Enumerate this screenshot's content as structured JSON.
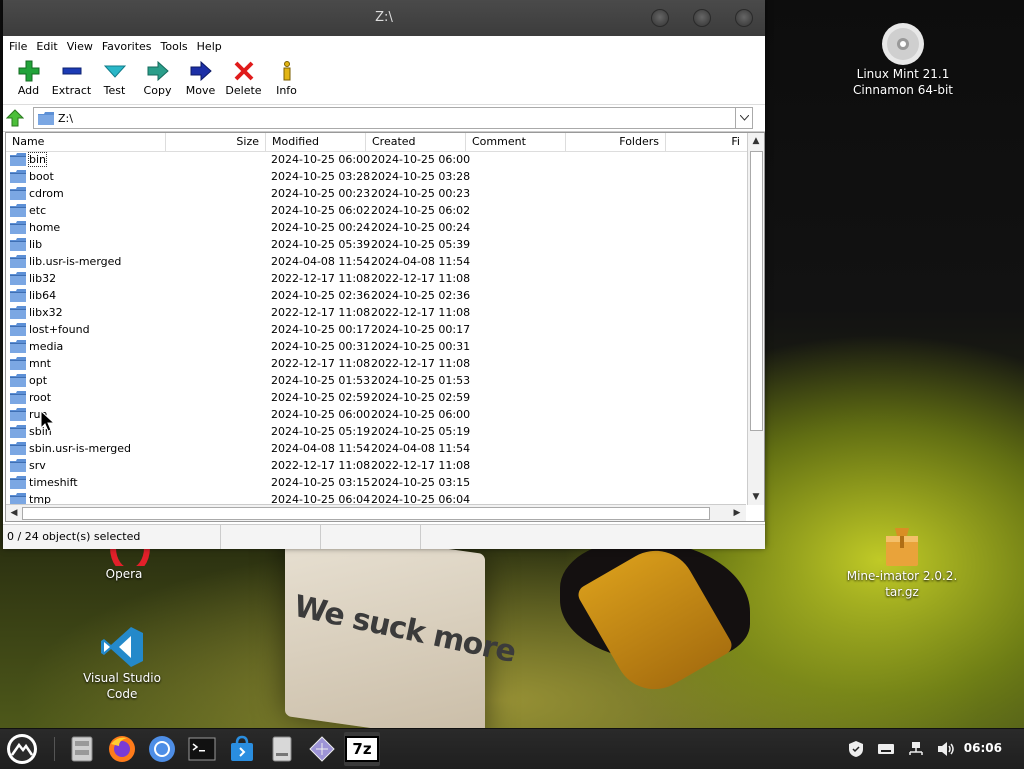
{
  "window": {
    "title": "Z:\\",
    "menu": [
      "File",
      "Edit",
      "View",
      "Favorites",
      "Tools",
      "Help"
    ],
    "toolbar": [
      {
        "label": "Add",
        "icon": "add-plus-icon"
      },
      {
        "label": "Extract",
        "icon": "extract-minus-icon"
      },
      {
        "label": "Test",
        "icon": "test-check-icon"
      },
      {
        "label": "Copy",
        "icon": "copy-arrow-icon"
      },
      {
        "label": "Move",
        "icon": "move-arrow-icon"
      },
      {
        "label": "Delete",
        "icon": "delete-x-icon"
      },
      {
        "label": "Info",
        "icon": "info-icon"
      }
    ],
    "address": "Z:\\",
    "columns": [
      "Name",
      "Size",
      "Modified",
      "Created",
      "Comment",
      "Folders",
      "Fi"
    ],
    "rows": [
      {
        "name": "bin",
        "modified": "2024-10-25 06:00",
        "created": "2024-10-25 06:00"
      },
      {
        "name": "boot",
        "modified": "2024-10-25 03:28",
        "created": "2024-10-25 03:28"
      },
      {
        "name": "cdrom",
        "modified": "2024-10-25 00:23",
        "created": "2024-10-25 00:23"
      },
      {
        "name": "etc",
        "modified": "2024-10-25 06:02",
        "created": "2024-10-25 06:02"
      },
      {
        "name": "home",
        "modified": "2024-10-25 00:24",
        "created": "2024-10-25 00:24"
      },
      {
        "name": "lib",
        "modified": "2024-10-25 05:39",
        "created": "2024-10-25 05:39"
      },
      {
        "name": "lib.usr-is-merged",
        "modified": "2024-04-08 11:54",
        "created": "2024-04-08 11:54"
      },
      {
        "name": "lib32",
        "modified": "2022-12-17 11:08",
        "created": "2022-12-17 11:08"
      },
      {
        "name": "lib64",
        "modified": "2024-10-25 02:36",
        "created": "2024-10-25 02:36"
      },
      {
        "name": "libx32",
        "modified": "2022-12-17 11:08",
        "created": "2022-12-17 11:08"
      },
      {
        "name": "lost+found",
        "modified": "2024-10-25 00:17",
        "created": "2024-10-25 00:17"
      },
      {
        "name": "media",
        "modified": "2024-10-25 00:31",
        "created": "2024-10-25 00:31"
      },
      {
        "name": "mnt",
        "modified": "2022-12-17 11:08",
        "created": "2022-12-17 11:08"
      },
      {
        "name": "opt",
        "modified": "2024-10-25 01:53",
        "created": "2024-10-25 01:53"
      },
      {
        "name": "root",
        "modified": "2024-10-25 02:59",
        "created": "2024-10-25 02:59"
      },
      {
        "name": "run",
        "modified": "2024-10-25 06:00",
        "created": "2024-10-25 06:00"
      },
      {
        "name": "sbin",
        "modified": "2024-10-25 05:19",
        "created": "2024-10-25 05:19"
      },
      {
        "name": "sbin.usr-is-merged",
        "modified": "2024-04-08 11:54",
        "created": "2024-04-08 11:54"
      },
      {
        "name": "srv",
        "modified": "2022-12-17 11:08",
        "created": "2022-12-17 11:08"
      },
      {
        "name": "timeshift",
        "modified": "2024-10-25 03:15",
        "created": "2024-10-25 03:15"
      },
      {
        "name": "tmp",
        "modified": "2024-10-25 06:04",
        "created": "2024-10-25 06:04"
      }
    ],
    "status": "0 / 24 object(s) selected"
  },
  "desktop": {
    "disc_label_1": "Linux Mint 21.1",
    "disc_label_2": "Cinnamon 64-bit",
    "opera_label": "Opera",
    "vscode_label_1": "Visual Studio",
    "vscode_label_2": "Code",
    "archive_label_1": "Mine-imator 2.0.2.",
    "archive_label_2": "tar.gz",
    "wallpaper_text": "We suck more"
  },
  "taskbar": {
    "clock": "06:06",
    "apps": [
      "mint-menu-icon",
      "file-manager-icon",
      "firefox-icon",
      "chromium-icon",
      "terminal-icon",
      "software-manager-icon",
      "drive-icon",
      "editor-icon",
      "7zip-icon"
    ],
    "pinned_7z_label": "7z"
  },
  "colors": {
    "folder": "#5d90d6",
    "accent_green": "#22a33a",
    "delete_red": "#e01b1b"
  }
}
